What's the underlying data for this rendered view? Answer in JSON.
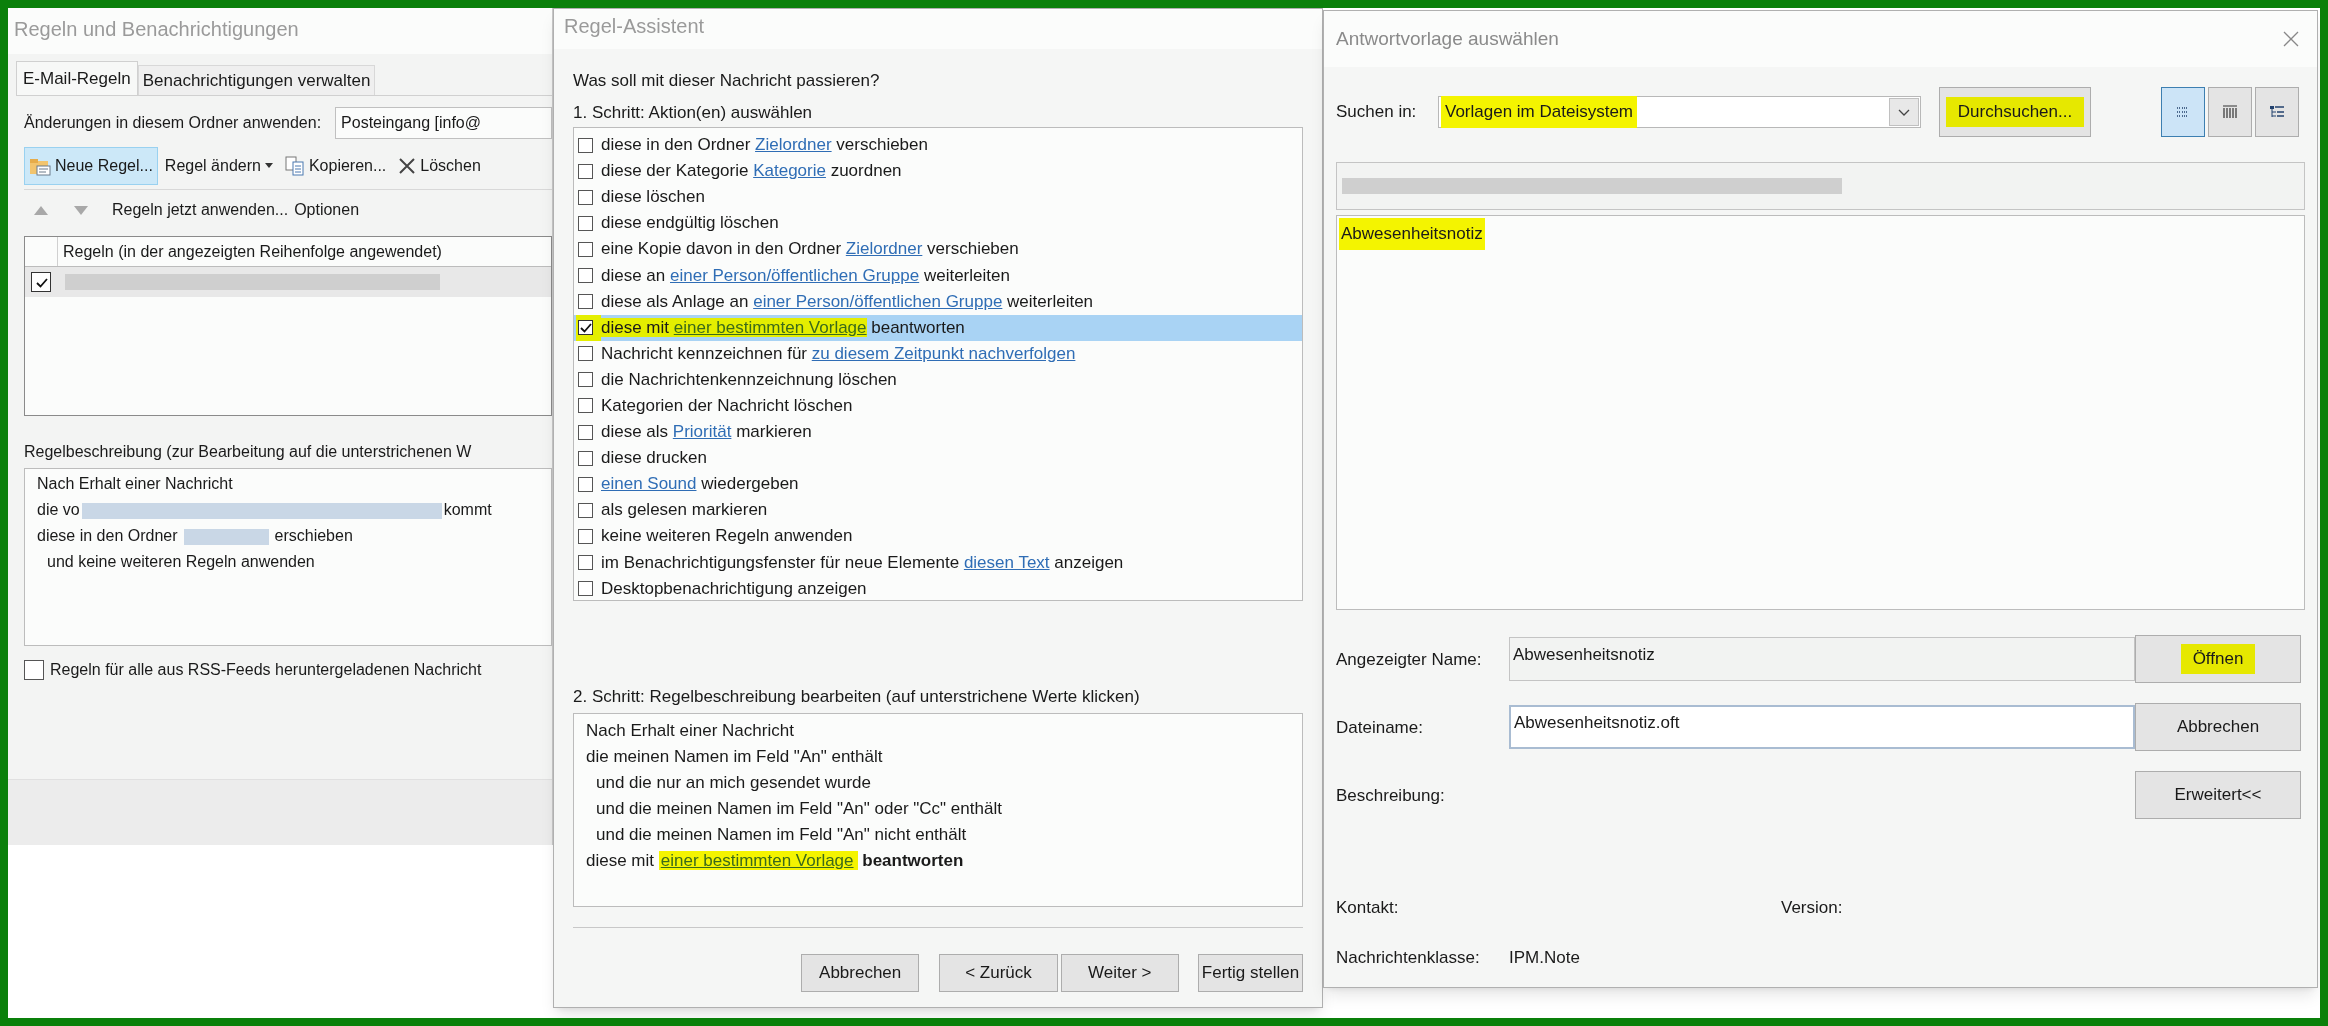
{
  "rules_window": {
    "title": "Regeln und Benachrichtigungen",
    "tabs": [
      {
        "label": "E-Mail-Regeln",
        "selected": true
      },
      {
        "label": "Benachrichtigungen verwalten",
        "selected": false
      }
    ],
    "folder": {
      "label": "Änderungen in diesem Ordner anwenden:",
      "value": "Posteingang [info@"
    },
    "toolbar": [
      {
        "kind": "new",
        "label": "Neue Regel...",
        "selected": true
      },
      {
        "kind": "menu",
        "label": "Regel ändern",
        "selected": false
      },
      {
        "kind": "copy",
        "label": "Kopieren...",
        "selected": false
      },
      {
        "kind": "delete",
        "label": "Löschen",
        "selected": false
      }
    ],
    "actions": [
      "Regeln jetzt anwenden...",
      "Optionen"
    ],
    "table": {
      "columns": [
        "Regeln (in der angezeigten Reihenfolge angewendet)"
      ],
      "rows": [
        {
          "checked": true
        }
      ]
    },
    "description_label": "Regelbeschreibung (zur Bearbeitung auf die unterstrichenen W",
    "description": [
      {
        "parts": [
          {
            "kind": "text",
            "text": "Nach Erhalt einer Nachricht"
          }
        ]
      },
      {
        "parts": [
          {
            "kind": "text",
            "text": "die vo"
          },
          {
            "kind": "redacted_long"
          },
          {
            "kind": "text",
            "text": "kommt"
          }
        ]
      },
      {
        "parts": [
          {
            "kind": "text",
            "text": "diese in den Ordner"
          },
          {
            "kind": "redacted_short"
          },
          {
            "kind": "text",
            "text": "erschieben"
          }
        ],
        "children": [
          {
            "parts": [
              {
                "kind": "text",
                "text": "und keine weiteren Regeln anwenden"
              }
            ]
          }
        ]
      }
    ],
    "rss": {
      "label": "Regeln für alle aus RSS-Feeds heruntergeladenen Nachricht",
      "checked": false
    }
  },
  "wizard": {
    "title": "Regel-Assistent",
    "question": "Was soll mit dieser Nachricht passieren?",
    "step1": "1. Schritt: Aktion(en) auswählen",
    "actions": [
      {
        "checked": false,
        "selected": false,
        "highlighted": false,
        "parts": [
          {
            "kind": "text",
            "text": "diese in den Ordner "
          },
          {
            "kind": "link",
            "text": "Zielordner"
          },
          {
            "kind": "text",
            "text": " verschieben"
          }
        ]
      },
      {
        "checked": false,
        "selected": false,
        "highlighted": false,
        "parts": [
          {
            "kind": "text",
            "text": "diese der Kategorie "
          },
          {
            "kind": "link",
            "text": "Kategorie"
          },
          {
            "kind": "text",
            "text": " zuordnen"
          }
        ]
      },
      {
        "checked": false,
        "selected": false,
        "highlighted": false,
        "parts": [
          {
            "kind": "text",
            "text": "diese löschen"
          }
        ]
      },
      {
        "checked": false,
        "selected": false,
        "highlighted": false,
        "parts": [
          {
            "kind": "text",
            "text": "diese endgültig löschen"
          }
        ]
      },
      {
        "checked": false,
        "selected": false,
        "highlighted": false,
        "parts": [
          {
            "kind": "text",
            "text": "eine Kopie davon in den Ordner "
          },
          {
            "kind": "link",
            "text": "Zielordner"
          },
          {
            "kind": "text",
            "text": " verschieben"
          }
        ]
      },
      {
        "checked": false,
        "selected": false,
        "highlighted": false,
        "parts": [
          {
            "kind": "text",
            "text": "diese an "
          },
          {
            "kind": "link",
            "text": "einer Person/öffentlichen Gruppe"
          },
          {
            "kind": "text",
            "text": " weiterleiten"
          }
        ]
      },
      {
        "checked": false,
        "selected": false,
        "highlighted": false,
        "parts": [
          {
            "kind": "text",
            "text": "diese als Anlage an "
          },
          {
            "kind": "link",
            "text": "einer Person/öffentlichen Gruppe"
          },
          {
            "kind": "text",
            "text": " weiterleiten"
          }
        ]
      },
      {
        "checked": true,
        "selected": true,
        "highlighted": true,
        "parts": [
          {
            "kind": "text",
            "text": "diese mit "
          },
          {
            "kind": "link",
            "text": "einer bestimmten Vorlage"
          },
          {
            "kind": "text",
            "text": " beantworten"
          }
        ]
      },
      {
        "checked": false,
        "selected": false,
        "highlighted": false,
        "parts": [
          {
            "kind": "text",
            "text": "Nachricht kennzeichnen für "
          },
          {
            "kind": "link",
            "text": "zu diesem Zeitpunkt nachverfolgen"
          }
        ]
      },
      {
        "checked": false,
        "selected": false,
        "highlighted": false,
        "parts": [
          {
            "kind": "text",
            "text": "die Nachrichtenkennzeichnung löschen"
          }
        ]
      },
      {
        "checked": false,
        "selected": false,
        "highlighted": false,
        "parts": [
          {
            "kind": "text",
            "text": "Kategorien der Nachricht löschen"
          }
        ]
      },
      {
        "checked": false,
        "selected": false,
        "highlighted": false,
        "parts": [
          {
            "kind": "text",
            "text": "diese als "
          },
          {
            "kind": "link",
            "text": "Priorität"
          },
          {
            "kind": "text",
            "text": " markieren"
          }
        ]
      },
      {
        "checked": false,
        "selected": false,
        "highlighted": false,
        "parts": [
          {
            "kind": "text",
            "text": "diese drucken"
          }
        ]
      },
      {
        "checked": false,
        "selected": false,
        "highlighted": false,
        "parts": [
          {
            "kind": "link",
            "text": "einen Sound"
          },
          {
            "kind": "text",
            "text": " wiedergeben"
          }
        ]
      },
      {
        "checked": false,
        "selected": false,
        "highlighted": false,
        "parts": [
          {
            "kind": "text",
            "text": "als gelesen markieren"
          }
        ]
      },
      {
        "checked": false,
        "selected": false,
        "highlighted": false,
        "parts": [
          {
            "kind": "text",
            "text": "keine weiteren Regeln anwenden"
          }
        ]
      },
      {
        "checked": false,
        "selected": false,
        "highlighted": false,
        "parts": [
          {
            "kind": "text",
            "text": "im Benachrichtigungsfenster für neue Elemente "
          },
          {
            "kind": "link",
            "text": "diesen Text"
          },
          {
            "kind": "text",
            "text": " anzeigen"
          }
        ]
      },
      {
        "checked": false,
        "selected": false,
        "highlighted": false,
        "parts": [
          {
            "kind": "text",
            "text": "Desktopbenachrichtigung anzeigen"
          }
        ]
      }
    ],
    "step2": "2. Schritt: Regelbeschreibung bearbeiten (auf unterstrichene Werte klicken)",
    "description": [
      {
        "parts": [
          {
            "kind": "text",
            "text": "Nach Erhalt einer Nachricht"
          }
        ]
      },
      {
        "parts": [
          {
            "kind": "text",
            "text": "die meinen Namen im Feld \"An\" enthält"
          }
        ],
        "children": [
          {
            "parts": [
              {
                "kind": "text",
                "text": "und die nur an mich gesendet wurde"
              }
            ]
          },
          {
            "parts": [
              {
                "kind": "text",
                "text": "und die meinen Namen im Feld \"An\" oder \"Cc\" enthält"
              }
            ]
          },
          {
            "parts": [
              {
                "kind": "text",
                "text": "und die meinen Namen im Feld \"An\" nicht enthält"
              }
            ]
          }
        ]
      },
      {
        "parts": [
          {
            "kind": "text",
            "text": "diese mit "
          },
          {
            "kind": "marked_link",
            "text": "einer bestimmten Vorlage"
          },
          {
            "kind": "bold",
            "text": " beantworten"
          }
        ]
      }
    ],
    "buttons": [
      "Abbrechen",
      "< Zurück",
      "Weiter >",
      "Fertig stellen"
    ]
  },
  "template_dialog": {
    "title": "Antwortvorlage auswählen",
    "look_in": {
      "label": "Suchen in:",
      "value": "Vorlagen im Dateisystem",
      "highlighted": true
    },
    "browse": {
      "label": "Durchsuchen...",
      "highlighted": true
    },
    "views": [
      {
        "kind": "list",
        "selected": true
      },
      {
        "kind": "details",
        "selected": false
      },
      {
        "kind": "tree",
        "selected": false
      }
    ],
    "files": [
      {
        "name": "Abwesenheitsnotiz",
        "highlighted": true
      }
    ],
    "fields": [
      {
        "kind": "readonly",
        "label": "Angezeigter Name:",
        "value": "Abwesenheitsnotiz"
      },
      {
        "kind": "input",
        "label": "Dateiname:",
        "value": "Abwesenheitsnotiz.oft"
      },
      {
        "kind": "empty",
        "label": "Beschreibung:"
      }
    ],
    "buttons": [
      {
        "label": "Öffnen",
        "highlighted": true
      },
      {
        "label": "Abbrechen",
        "highlighted": false
      },
      {
        "label": "Erweitert<<",
        "highlighted": false
      }
    ],
    "info": [
      "Kontakt:",
      "Version:"
    ],
    "message_class": {
      "label": "Nachrichtenklasse:",
      "value": "IPM.Note"
    }
  }
}
